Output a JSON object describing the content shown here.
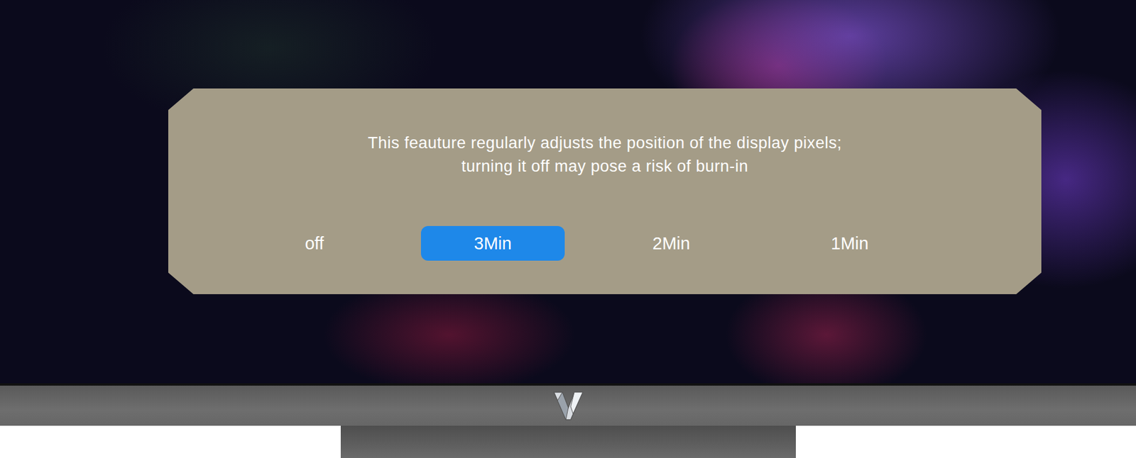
{
  "dialog": {
    "message_lines": [
      "This feauture regularly adjusts the position of the display pixels;",
      "turning it off may pose a risk of burn-in"
    ],
    "options": [
      {
        "label": "off",
        "selected": false
      },
      {
        "label": "3Min",
        "selected": true
      },
      {
        "label": "2Min",
        "selected": false
      },
      {
        "label": "1Min",
        "selected": false
      }
    ]
  }
}
